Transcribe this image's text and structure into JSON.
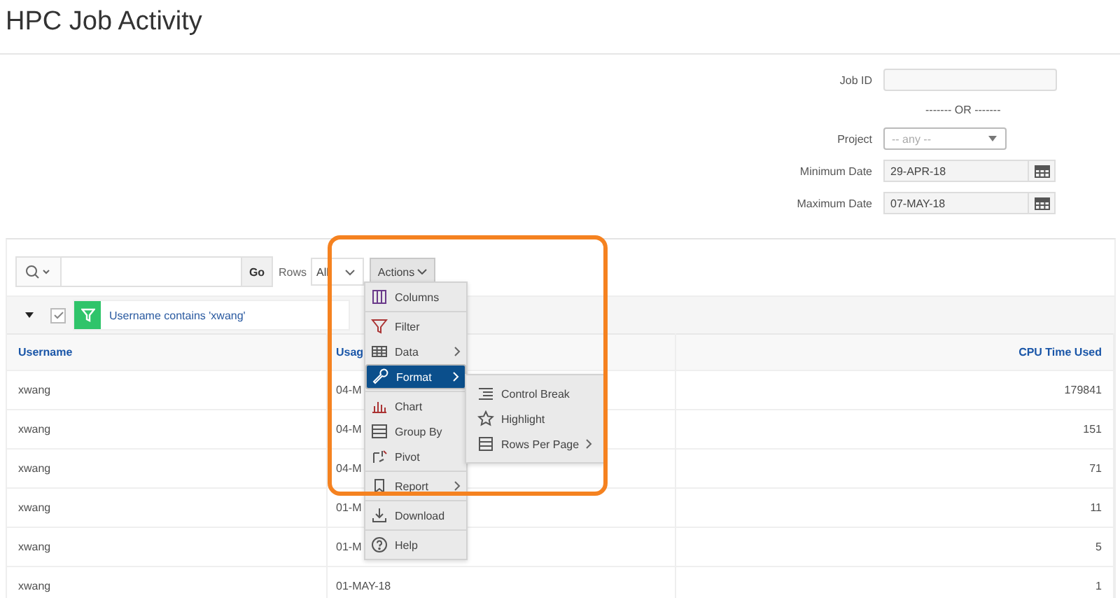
{
  "page": {
    "title": "HPC Job Activity"
  },
  "form": {
    "fields": [
      {
        "kind": "text",
        "label": "Job ID"
      },
      {
        "kind": "divider",
        "label": "------- OR -------"
      },
      {
        "kind": "select",
        "label": "Project",
        "placeholder": "-- any --"
      },
      {
        "kind": "date",
        "label": "Minimum Date",
        "value": "29-APR-18"
      },
      {
        "kind": "date",
        "label": "Maximum Date",
        "value": "07-MAY-18"
      }
    ]
  },
  "toolbar": {
    "go": "Go",
    "rows_label": "Rows",
    "rows_value": "All",
    "actions": "Actions"
  },
  "filter": {
    "enabled": true,
    "text": "Username contains 'xwang'"
  },
  "table": {
    "columns": [
      "Username",
      "Usag",
      "CPU Time Used"
    ],
    "rows": [
      [
        "xwang",
        "04-M",
        "179841"
      ],
      [
        "xwang",
        "04-M",
        "151"
      ],
      [
        "xwang",
        "04-M",
        "71"
      ],
      [
        "xwang",
        "01-M",
        "11"
      ],
      [
        "xwang",
        "01-M",
        "5"
      ],
      [
        "xwang",
        "01-MAY-18",
        "1"
      ]
    ]
  },
  "actions_menu": {
    "groups": [
      [
        {
          "label": "Columns",
          "submenu": false,
          "selected": false
        }
      ],
      [
        {
          "label": "Filter",
          "submenu": false,
          "selected": false
        },
        {
          "label": "Data",
          "submenu": true,
          "selected": false
        },
        {
          "label": "Format",
          "submenu": true,
          "selected": true
        }
      ],
      [
        {
          "label": "Chart",
          "submenu": false,
          "selected": false
        },
        {
          "label": "Group By",
          "submenu": false,
          "selected": false
        },
        {
          "label": "Pivot",
          "submenu": false,
          "selected": false
        }
      ],
      [
        {
          "label": "Report",
          "submenu": true,
          "selected": false
        }
      ],
      [
        {
          "label": "Download",
          "submenu": false,
          "selected": false
        }
      ],
      [
        {
          "label": "Help",
          "submenu": false,
          "selected": false
        }
      ]
    ],
    "format_submenu": [
      {
        "label": "Control Break",
        "submenu": false
      },
      {
        "label": "Highlight",
        "submenu": false
      },
      {
        "label": "Rows Per Page",
        "submenu": true
      }
    ]
  }
}
